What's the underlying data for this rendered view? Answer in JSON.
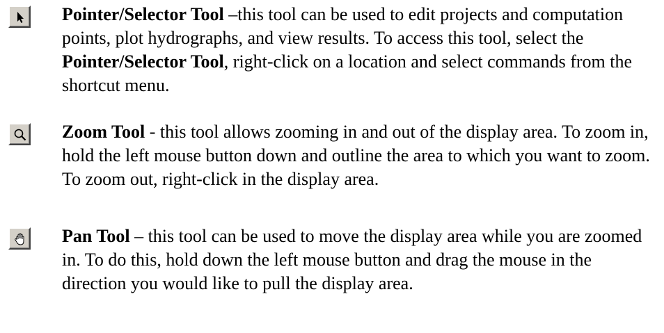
{
  "tools": [
    {
      "icon": "pointer-arrow-icon",
      "name": "Pointer/Selector Tool",
      "desc_part1": " –this tool can be used to edit projects and computation points, plot hydrographs, and view results.  To access this tool, select the ",
      "name_repeat": "Pointer/Selector Tool",
      "desc_part2": ", right-click on a location and select commands from the shortcut menu."
    },
    {
      "icon": "magnifier-icon",
      "name": "Zoom Tool",
      "description": " - this tool allows zooming in and out of the display area.  To zoom in, hold the left mouse button down and outline the area to which you want to zoom.  To zoom out, right-click in the display area."
    },
    {
      "icon": "hand-icon",
      "name": "Pan Tool",
      "description": " – this tool can be used to move the display area while you are zoomed in.  To do this, hold down the left mouse button and drag the mouse in the direction you would like to pull the display area."
    }
  ]
}
